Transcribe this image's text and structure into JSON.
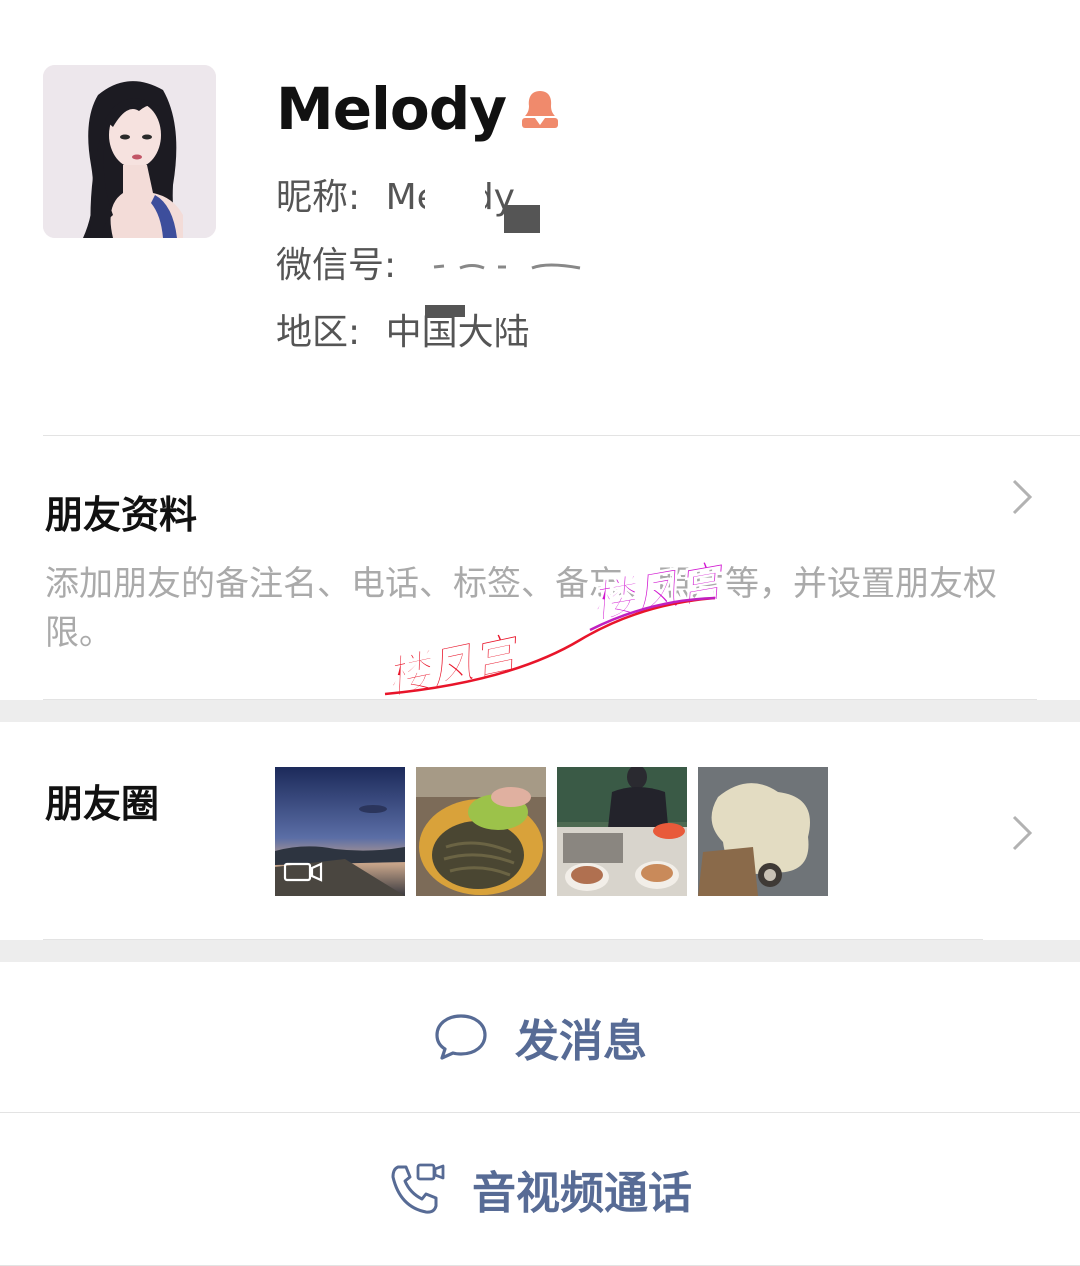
{
  "profile": {
    "name": "Melody",
    "nickname_label": "昵称:",
    "nickname_value": "Melody",
    "wechat_id_label": "微信号:",
    "wechat_id_value": "",
    "region_label": "地区:",
    "region_value": "中国大陆",
    "gender_icon": "female-icon"
  },
  "friend_info": {
    "title": "朋友资料",
    "description": "添加朋友的备注名、电话、标签、备忘、照片等，并设置朋友权限。"
  },
  "moments": {
    "title": "朋友圈",
    "thumbnails": [
      {
        "subject": "sunset-seaside-video",
        "is_video": true
      },
      {
        "subject": "hotpot-greens-noodles",
        "is_video": false
      },
      {
        "subject": "person-at-dining-table",
        "is_video": false
      },
      {
        "subject": "spilled-drink-on-ground",
        "is_video": false
      }
    ]
  },
  "actions": {
    "message_label": "发消息",
    "call_label": "音视频通话"
  },
  "watermark": {
    "text_1": "楼凤宫",
    "text_2": "楼凤宫"
  },
  "colors": {
    "link": "#576b95",
    "secondary_text": "#aaaaaa",
    "gender_female": "#f08a6c",
    "separator": "#ededed"
  }
}
